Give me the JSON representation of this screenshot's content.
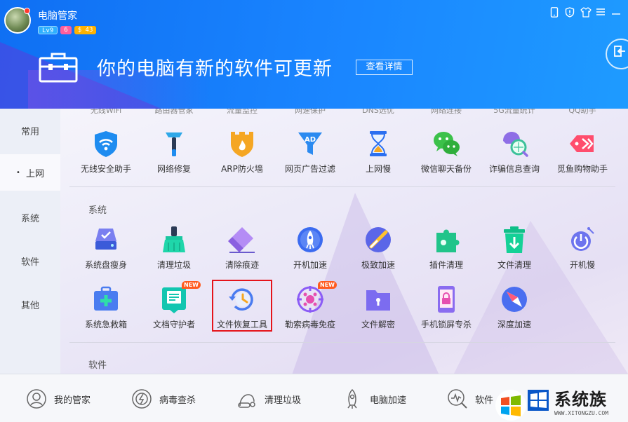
{
  "header": {
    "app_title": "电脑管家",
    "level_badge": "Lv9",
    "msg_badge": "6",
    "coin_badge": "$ 43",
    "banner_text": "你的电脑有新的软件可更新",
    "details_button": "查看详情"
  },
  "sidebar": {
    "items": [
      {
        "label": "常用"
      },
      {
        "label": "上网"
      },
      {
        "label": "系统"
      },
      {
        "label": "软件"
      },
      {
        "label": "其他"
      }
    ]
  },
  "content": {
    "cutoff_labels": [
      "无线WiFi",
      "路由器管家",
      "流量监控",
      "网速保护",
      "DNS选优",
      "网络连接",
      "5G流量统计",
      "QQ助手"
    ],
    "row_web": [
      {
        "label": "无线安全助手",
        "icon": "wifi-shield-icon"
      },
      {
        "label": "网络修复",
        "icon": "hammer-icon"
      },
      {
        "label": "ARP防火墙",
        "icon": "firewall-icon"
      },
      {
        "label": "网页广告过滤",
        "icon": "ad-filter-icon"
      },
      {
        "label": "上网慢",
        "icon": "hourglass-icon"
      },
      {
        "label": "微信聊天备份",
        "icon": "wechat-icon"
      },
      {
        "label": "诈骗信息查询",
        "icon": "fraud-search-icon"
      },
      {
        "label": "觅鱼购物助手",
        "icon": "fish-tag-icon"
      }
    ],
    "section_system": "系统",
    "row_system_1": [
      {
        "label": "系统盘瘦身",
        "icon": "disk-icon"
      },
      {
        "label": "清理垃圾",
        "icon": "broom-icon"
      },
      {
        "label": "清除痕迹",
        "icon": "eraser-icon"
      },
      {
        "label": "开机加速",
        "icon": "rocket-icon"
      },
      {
        "label": "极致加速",
        "icon": "speed-icon"
      },
      {
        "label": "插件清理",
        "icon": "puzzle-icon"
      },
      {
        "label": "文件清理",
        "icon": "trash-icon"
      },
      {
        "label": "开机慢",
        "icon": "power-icon"
      }
    ],
    "row_system_2": [
      {
        "label": "系统急救箱",
        "icon": "first-aid-icon"
      },
      {
        "label": "文档守护者",
        "icon": "document-guard-icon",
        "badge": "NEW"
      },
      {
        "label": "文件恢复工具",
        "icon": "file-restore-icon"
      },
      {
        "label": "勒索病毒免疫",
        "icon": "virus-immune-icon",
        "badge": "NEW"
      },
      {
        "label": "文件解密",
        "icon": "folder-lock-icon"
      },
      {
        "label": "手机锁屏专杀",
        "icon": "phone-lock-icon"
      },
      {
        "label": "深度加速",
        "icon": "compass-icon"
      }
    ],
    "section_software": "软件"
  },
  "bottom_bar": {
    "items": [
      {
        "label": "我的管家",
        "icon": "butler-icon"
      },
      {
        "label": "病毒查杀",
        "icon": "virus-scan-icon"
      },
      {
        "label": "清理垃圾",
        "icon": "vacuum-icon"
      },
      {
        "label": "电脑加速",
        "icon": "rocket-outline-icon"
      },
      {
        "label": "软件",
        "icon": "software-icon"
      }
    ]
  },
  "watermark": {
    "text": "系统族",
    "url_text": "WWW.XITONGZU.COM"
  },
  "colors": {
    "header_blue": "#1a86ff",
    "highlight_red": "#e5141b",
    "new_badge": "#ff5a1f"
  }
}
